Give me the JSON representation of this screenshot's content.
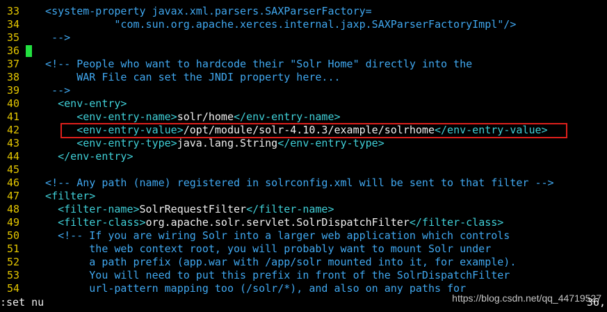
{
  "editor": {
    "lines": [
      {
        "num": "33",
        "segments": [
          {
            "t": "  <system-property javax.xml.parsers.SAXParserFactory=",
            "c": "comment"
          }
        ]
      },
      {
        "num": "34",
        "segments": [
          {
            "t": "             \"com.sun.org.apache.xerces.internal.jaxp.SAXParserFactoryImpl\"/>",
            "c": "comment"
          }
        ]
      },
      {
        "num": "35",
        "segments": [
          {
            "t": "   -->",
            "c": "comment"
          }
        ]
      },
      {
        "num": "36",
        "segments": [],
        "cursor": true
      },
      {
        "num": "37",
        "segments": [
          {
            "t": "  <!-- People who want to hardcode their \"Solr Home\" directly into the",
            "c": "comment"
          }
        ]
      },
      {
        "num": "38",
        "segments": [
          {
            "t": "       WAR File can set the JNDI property here...",
            "c": "comment"
          }
        ]
      },
      {
        "num": "39",
        "segments": [
          {
            "t": "   -->",
            "c": "comment"
          }
        ]
      },
      {
        "num": "40",
        "segments": [
          {
            "t": "    <env-entry>",
            "c": "tag"
          }
        ]
      },
      {
        "num": "41",
        "segments": [
          {
            "t": "       <env-entry-name>",
            "c": "tag"
          },
          {
            "t": "solr/home",
            "c": "text"
          },
          {
            "t": "</env-entry-name>",
            "c": "tag"
          }
        ]
      },
      {
        "num": "42",
        "segments": [
          {
            "t": "       <env-entry-value>",
            "c": "tag"
          },
          {
            "t": "/opt/module/solr-4.10.3/example/solrhome",
            "c": "text"
          },
          {
            "t": "</env-entry-value>",
            "c": "tag"
          }
        ]
      },
      {
        "num": "43",
        "segments": [
          {
            "t": "       <env-entry-type>",
            "c": "tag"
          },
          {
            "t": "java.lang.String",
            "c": "text"
          },
          {
            "t": "</env-entry-type>",
            "c": "tag"
          }
        ]
      },
      {
        "num": "44",
        "segments": [
          {
            "t": "    </env-entry>",
            "c": "tag"
          }
        ]
      },
      {
        "num": "45",
        "segments": []
      },
      {
        "num": "46",
        "segments": [
          {
            "t": "  <!-- Any path (name) registered in solrconfig.xml will be sent to that filter -->",
            "c": "comment"
          }
        ]
      },
      {
        "num": "47",
        "segments": [
          {
            "t": "  <filter>",
            "c": "tag"
          }
        ]
      },
      {
        "num": "48",
        "segments": [
          {
            "t": "    <filter-name>",
            "c": "tag"
          },
          {
            "t": "SolrRequestFilter",
            "c": "text"
          },
          {
            "t": "</filter-name>",
            "c": "tag"
          }
        ]
      },
      {
        "num": "49",
        "segments": [
          {
            "t": "    <filter-class>",
            "c": "tag"
          },
          {
            "t": "org.apache.solr.servlet.SolrDispatchFilter",
            "c": "text"
          },
          {
            "t": "</filter-class>",
            "c": "tag"
          }
        ]
      },
      {
        "num": "50",
        "segments": [
          {
            "t": "    <!-- If you are wiring Solr into a larger web application which controls",
            "c": "comment"
          }
        ]
      },
      {
        "num": "51",
        "segments": [
          {
            "t": "         the web context root, you will probably want to mount Solr under",
            "c": "comment"
          }
        ]
      },
      {
        "num": "52",
        "segments": [
          {
            "t": "         a path prefix (app.war with /app/solr mounted into it, for example).",
            "c": "comment"
          }
        ]
      },
      {
        "num": "53",
        "segments": [
          {
            "t": "         You will need to put this prefix in front of the SolrDispatchFilter",
            "c": "comment"
          }
        ]
      },
      {
        "num": "54",
        "segments": [
          {
            "t": "         url-pattern mapping too (/solr/*), and also on any paths for",
            "c": "comment"
          }
        ]
      }
    ]
  },
  "status": {
    "command": ":set nu",
    "position": "36,"
  },
  "watermark": "https://blog.csdn.net/qq_44719527",
  "colors": {
    "line_number": "#e5c700",
    "tag": "#40d0d8",
    "comment": "#40a8f0",
    "text": "#f0f0f0",
    "cursor": "#22e040",
    "highlight_box": "#e0201c",
    "background": "#000000"
  }
}
